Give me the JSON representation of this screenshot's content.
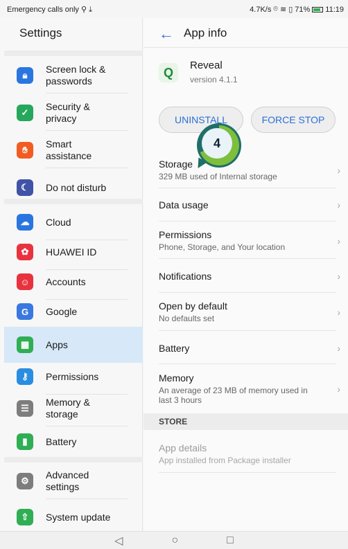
{
  "status": {
    "left_text": "Emergency calls only",
    "right_text": "4.7K/s",
    "battery_pct": "71%",
    "time": "11:19"
  },
  "left": {
    "title": "Settings",
    "items": [
      {
        "label": "Screen lock &\npasswords",
        "icon": "lock-icon",
        "color": "#2a76e0"
      },
      {
        "label": "Security &\nprivacy",
        "icon": "shield-icon",
        "color": "#25a85b"
      },
      {
        "label": "Smart\nassistance",
        "icon": "hand-icon",
        "color": "#f25c22"
      },
      {
        "label": "Do not disturb",
        "icon": "moon-icon",
        "color": "#4153a6"
      },
      {
        "label": "Cloud",
        "icon": "cloud-icon",
        "color": "#2a76e0"
      },
      {
        "label": "HUAWEI ID",
        "icon": "huawei-icon",
        "color": "#e8333f"
      },
      {
        "label": "Accounts",
        "icon": "account-icon",
        "color": "#e8333f"
      },
      {
        "label": "Google",
        "icon": "google-icon",
        "color": "#3a78e0"
      },
      {
        "label": "Apps",
        "icon": "apps-icon",
        "color": "#2fae54"
      },
      {
        "label": "Permissions",
        "icon": "key-icon",
        "color": "#2a8de0"
      },
      {
        "label": "Memory &\nstorage",
        "icon": "storage-icon",
        "color": "#7d7d7d"
      },
      {
        "label": "Battery",
        "icon": "battery-icon",
        "color": "#2fae54"
      },
      {
        "label": "Advanced\nsettings",
        "icon": "gear-icon",
        "color": "#7d7d7d"
      },
      {
        "label": "System update",
        "icon": "update-icon",
        "color": "#2fae54"
      }
    ]
  },
  "right": {
    "title": "App info",
    "app_name": "Reveal",
    "app_version": "version 4.1.1",
    "uninstall_label": "UNINSTALL",
    "force_stop_label": "FORCE STOP",
    "step_badge": "4",
    "rows": [
      {
        "title": "Storage",
        "subtitle": "329 MB used of Internal storage"
      },
      {
        "title": "Data usage",
        "subtitle": ""
      },
      {
        "title": "Permissions",
        "subtitle": "Phone, Storage, and Your location"
      },
      {
        "title": "Notifications",
        "subtitle": ""
      },
      {
        "title": "Open by default",
        "subtitle": "No defaults set"
      },
      {
        "title": "Battery",
        "subtitle": ""
      },
      {
        "title": "Memory",
        "subtitle": "An average of 23 MB of memory used in last 3 hours"
      }
    ],
    "section_label": "STORE",
    "store_row": {
      "title": "App details",
      "subtitle": "App installed from Package installer"
    }
  }
}
